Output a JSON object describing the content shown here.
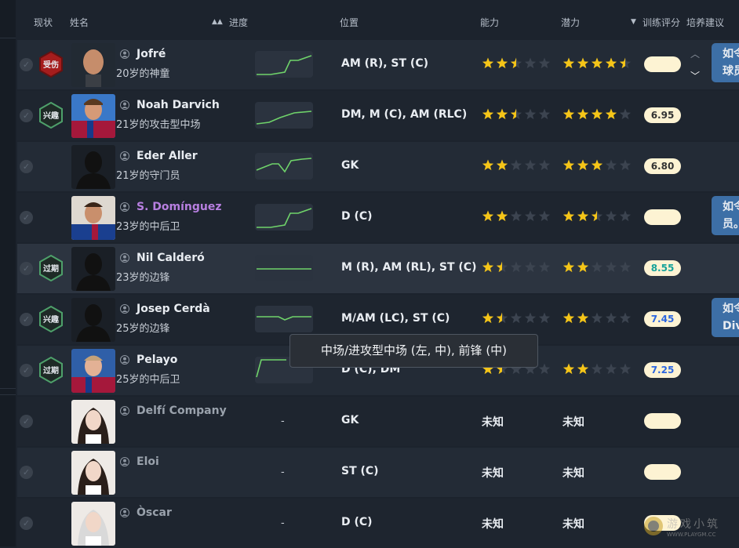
{
  "headers": {
    "status": "现状",
    "name": "姓名",
    "progress": "进度",
    "position": "位置",
    "ability": "能力",
    "potential": "潜力",
    "training": "训练评分",
    "advice": "培养建议"
  },
  "players": [
    {
      "name": "Jofré",
      "desc": "20岁的神童",
      "badge": "受伤",
      "badge_color": "#a51d1d",
      "position": "AM (R), ST (C)",
      "ability": 2.5,
      "potential": 4.5,
      "rating": "",
      "advice": "如令\n球员",
      "name_color": "#e8ecf1",
      "trend": "up"
    },
    {
      "name": "Noah Darvich",
      "desc": "21岁的攻击型中场",
      "badge": "兴趣",
      "badge_color": "#2e7d4f",
      "position": "DM, M (C), AM (RLC)",
      "ability": 2.5,
      "potential": 4,
      "rating": "6.95",
      "advice": "",
      "name_color": "#e8ecf1",
      "trend": "up2"
    },
    {
      "name": "Eder Aller",
      "desc": "21岁的守门员",
      "badge": "",
      "badge_color": "",
      "position": "GK",
      "ability": 2,
      "potential": 3,
      "rating": "6.80",
      "advice": "",
      "name_color": "#e8ecf1",
      "trend": "dip"
    },
    {
      "name": "S. Domínguez",
      "desc": "23岁的中后卫",
      "badge": "",
      "badge_color": "",
      "position": "D (C)",
      "ability": 2,
      "potential": 2.5,
      "rating": "",
      "advice": "如令\n员。",
      "name_color": "#b77fe0",
      "trend": "up"
    },
    {
      "name": "Nil Calderó",
      "desc": "23岁的边锋",
      "badge": "过期",
      "badge_color": "#2e7d4f",
      "position": "M (R), AM (RL), ST (C)",
      "ability": 1.5,
      "potential": 2,
      "rating": "8.55",
      "advice": "",
      "name_color": "#e8ecf1",
      "trend": "flat"
    },
    {
      "name": "Josep Cerdà",
      "desc": "25岁的边锋",
      "badge": "兴趣",
      "badge_color": "#2e7d4f",
      "position": "M/AM (LC), ST (C)",
      "ability": 1.5,
      "potential": 2,
      "rating": "7.45",
      "advice": "如令\nDiv",
      "name_color": "#e8ecf1",
      "trend": "flatdip"
    },
    {
      "name": "Pelayo",
      "desc": "25岁的中后卫",
      "badge": "过期",
      "badge_color": "#2e7d4f",
      "position": "D (C), DM",
      "ability": 1.5,
      "potential": 2,
      "rating": "7.25",
      "advice": "",
      "name_color": "#e8ecf1",
      "trend": "step"
    },
    {
      "name": "Delfí Company",
      "desc": "",
      "badge": "",
      "badge_color": "",
      "position": "GK",
      "ability_text": "未知",
      "potential_text": "未知",
      "rating": "",
      "advice": "",
      "name_color": "#9aa2ac",
      "trend": "none"
    },
    {
      "name": "Eloi",
      "desc": "",
      "badge": "",
      "badge_color": "",
      "position": "ST (C)",
      "ability_text": "未知",
      "potential_text": "未知",
      "rating": "",
      "advice": "",
      "name_color": "#9aa2ac",
      "trend": "none"
    },
    {
      "name": "Òscar",
      "desc": "",
      "badge": "",
      "badge_color": "",
      "position": "D (C)",
      "ability_text": "未知",
      "potential_text": "未知",
      "rating": "",
      "advice": "",
      "name_color": "#9aa2ac",
      "trend": "none"
    }
  ],
  "unknown_label": "未知",
  "progress_placeholder": "-",
  "tooltip": "中场/进攻型中场 (左, 中), 前锋 (中)",
  "watermark": {
    "text": "游戏小筑",
    "sub": "WWW.PLAYGM.CC"
  },
  "colors": {
    "star": "#f5c518",
    "star_empty": "#3c4450",
    "spark": "#6fd36a",
    "accent_row": "#2c3440"
  }
}
